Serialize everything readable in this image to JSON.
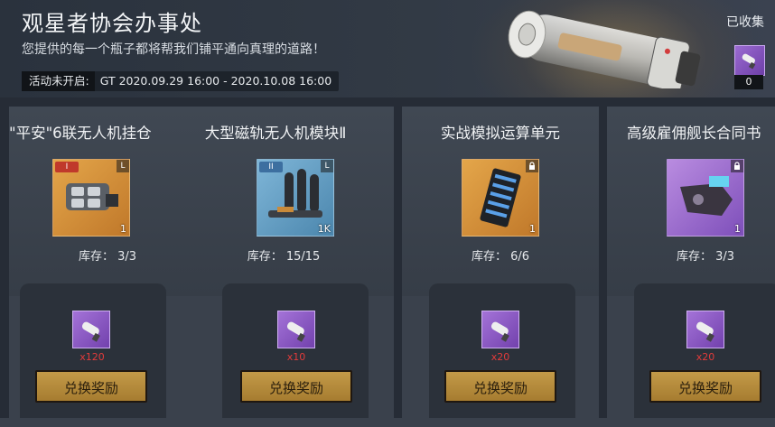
{
  "header": {
    "title": "观星者协会办事处",
    "subtitle": "您提供的每一个瓶子都将帮我们铺平通向真理的道路！",
    "period_label": "活动未开启:",
    "period_value": "GT 2020.09.29 16:00 - 2020.10.08 16:00",
    "collected_label": "已收集",
    "collected_count": "0"
  },
  "cards": [
    {
      "title": "\"平安\"6联无人机挂仓",
      "badge": "I",
      "size_tag": "L",
      "item_qty": "1",
      "stock_label": "库存：",
      "stock_value": "3/3",
      "cost": "x120",
      "button": "兑换奖励"
    },
    {
      "title": "大型磁轨无人机模块Ⅱ",
      "badge": "II",
      "size_tag": "L",
      "item_qty": "1K",
      "stock_label": "库存：",
      "stock_value": "15/15",
      "cost": "x10",
      "button": "兑换奖励"
    },
    {
      "title": "实战模拟运算单元",
      "item_qty": "1",
      "stock_label": "库存：",
      "stock_value": "6/6",
      "cost": "x20",
      "button": "兑换奖励"
    },
    {
      "title": "高级雇佣舰长合同书",
      "item_qty": "1",
      "stock_label": "库存：",
      "stock_value": "3/3",
      "cost": "x20",
      "button": "兑换奖励"
    }
  ],
  "icons": {
    "lock": "lock-icon",
    "bottle": "bottle-icon"
  },
  "colors": {
    "button_gold": "#b88d3e",
    "cost_red": "#e23b3b",
    "item_purple": "#8a5cc4",
    "item_orange": "#d89038",
    "item_blue": "#6aa2c8"
  }
}
